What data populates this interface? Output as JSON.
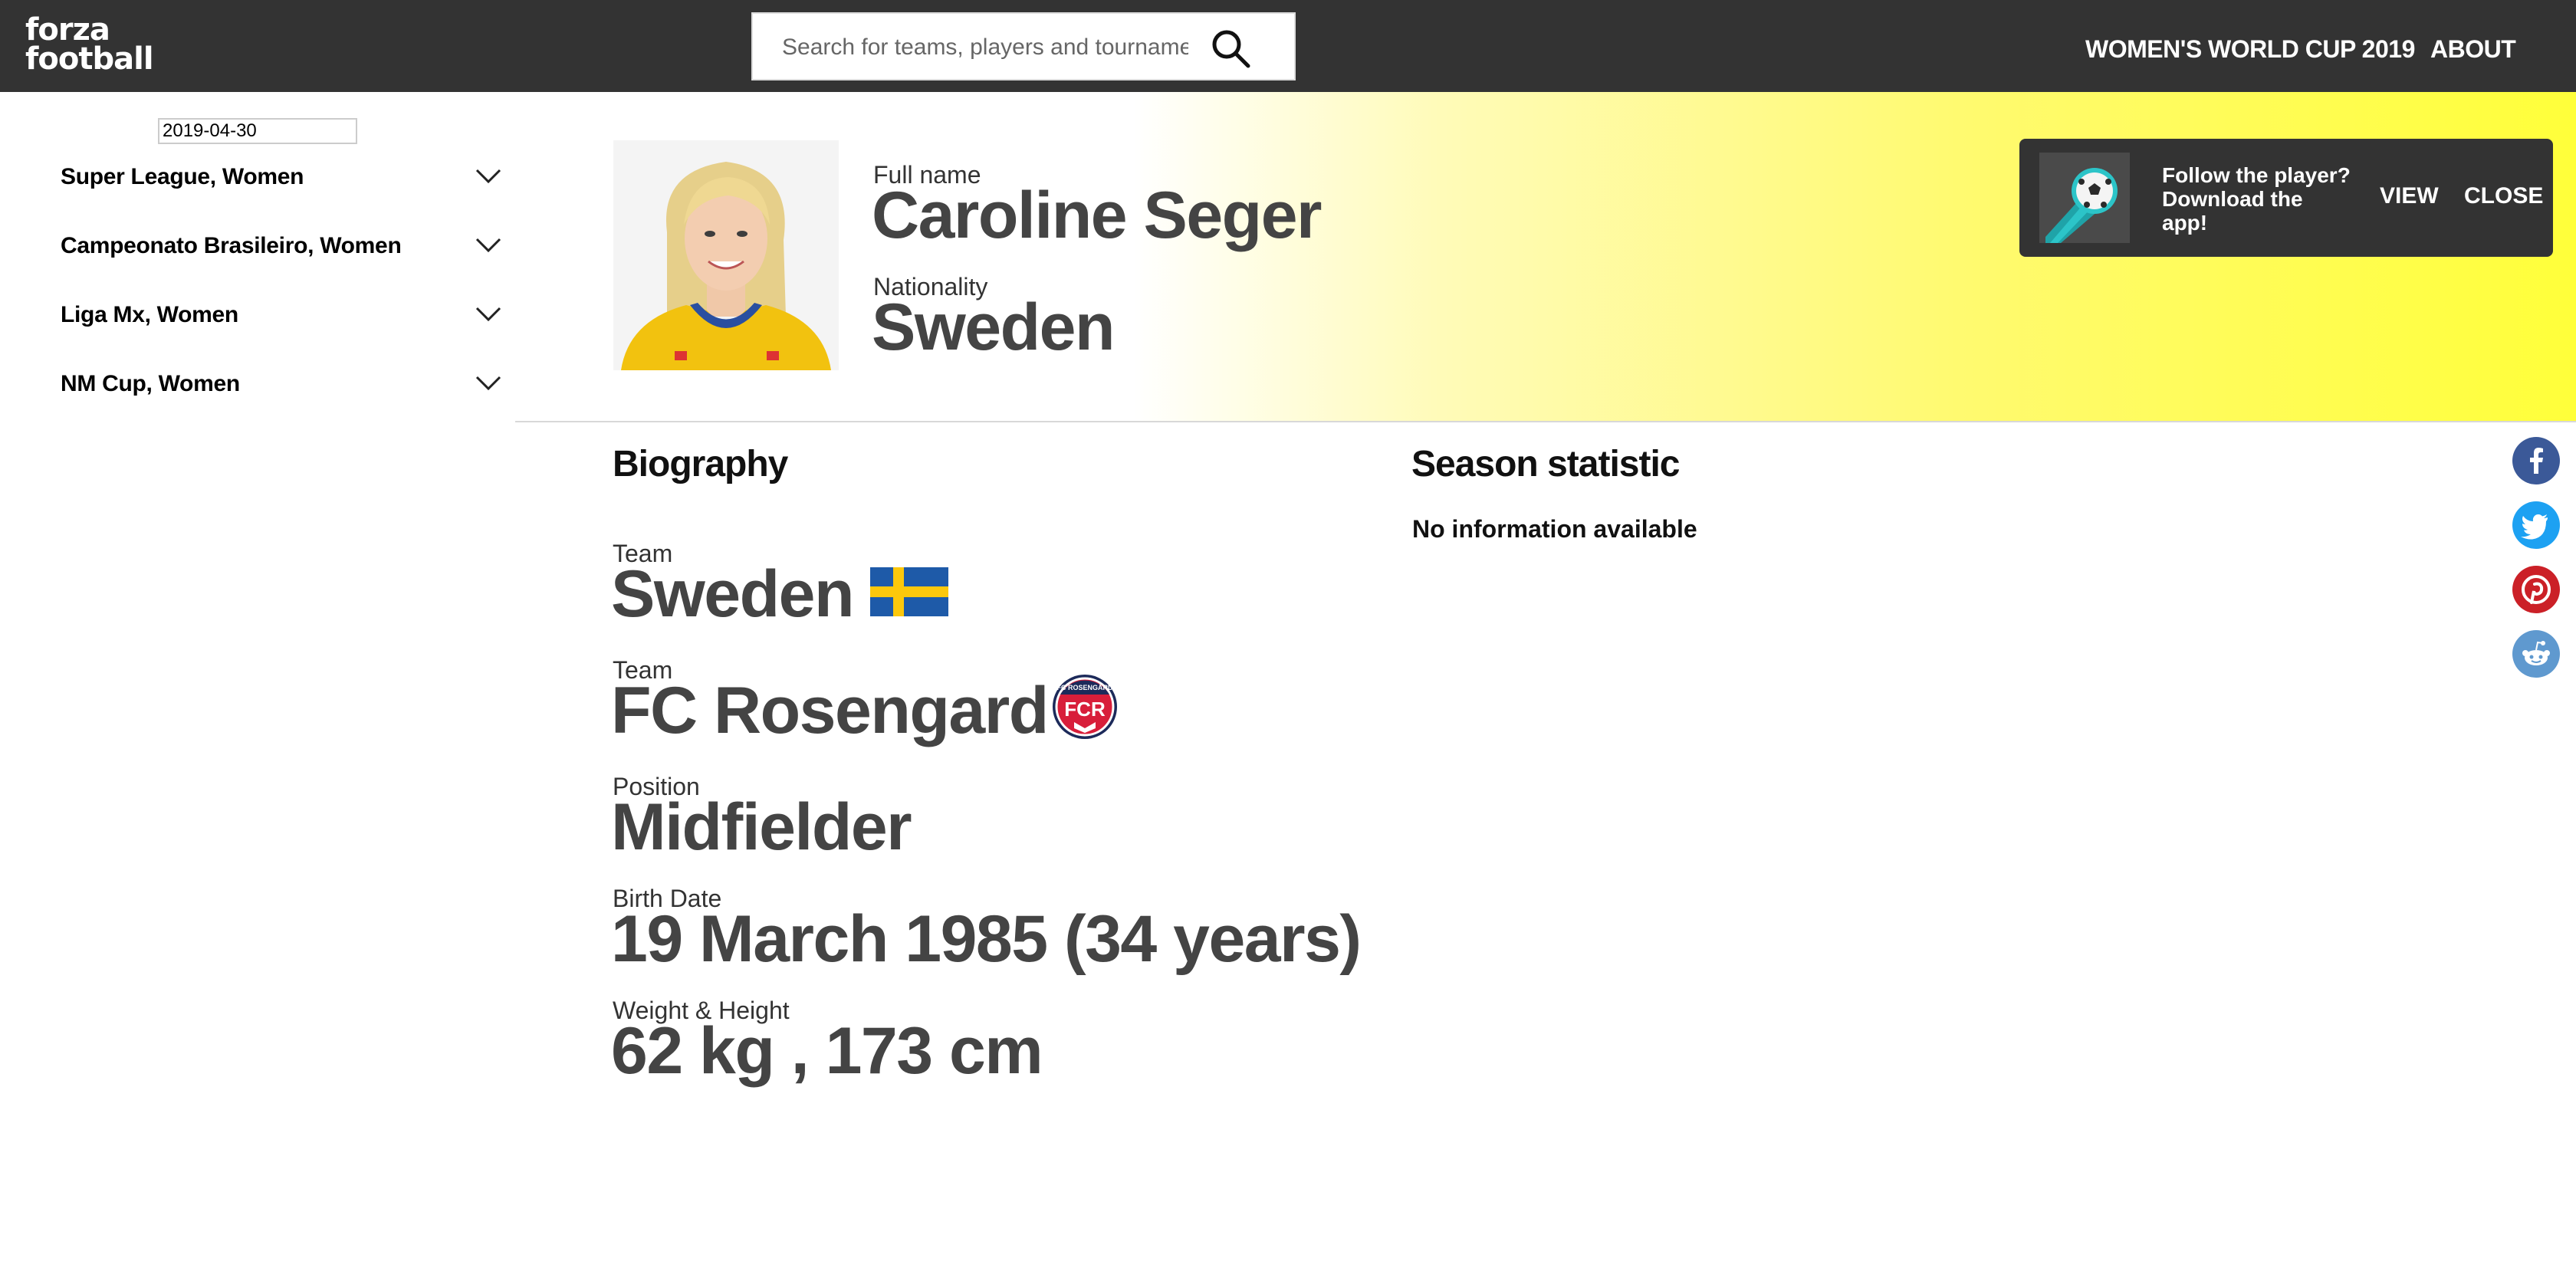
{
  "header": {
    "logo_line1": "forza",
    "logo_line2": "football",
    "search_placeholder": "Search for teams, players and tournaments",
    "nav": [
      "WOMEN'S WORLD CUP 2019",
      "ABOUT"
    ]
  },
  "sidebar": {
    "date_value": "2019-04-30",
    "leagues": [
      {
        "label": "Super League, Women"
      },
      {
        "label": "Campeonato Brasileiro, Women"
      },
      {
        "label": "Liga Mx, Women"
      },
      {
        "label": "NM Cup, Women"
      }
    ]
  },
  "player": {
    "full_name_label": "Full name",
    "full_name": "Caroline Seger",
    "nationality_label": "Nationality",
    "nationality": "Sweden"
  },
  "banner": {
    "text": "Follow the player? Download the app!",
    "view_label": "VIEW",
    "close_label": "CLOSE"
  },
  "biography": {
    "title": "Biography",
    "items": [
      {
        "label": "Team",
        "value": "Sweden",
        "badge": "sweden-flag-icon"
      },
      {
        "label": "Team",
        "value": "FC Rosengard",
        "badge": "fc-rosengard-crest-icon"
      },
      {
        "label": "Position",
        "value": "Midfielder"
      },
      {
        "label": "Birth Date",
        "value": "19 March 1985 (34 years)"
      },
      {
        "label": "Weight & Height",
        "value": "62 kg , 173 cm"
      }
    ]
  },
  "season": {
    "title": "Season statistic",
    "message": "No information available"
  },
  "crest_text": {
    "top": "FC ROSENGÅRD",
    "main": "FCR"
  },
  "social": [
    "facebook-icon",
    "twitter-icon",
    "pinterest-icon",
    "reddit-icon"
  ],
  "colors": {
    "header_bg": "#333333",
    "hero_yellow": "#ffff3a",
    "facebook": "#3b5998",
    "twitter": "#1da1f2",
    "pinterest": "#cb2027",
    "reddit": "#5f99cf"
  }
}
